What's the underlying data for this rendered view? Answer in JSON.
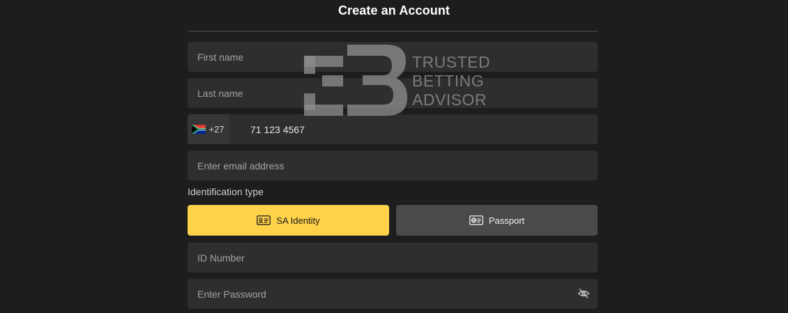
{
  "header": {
    "title": "Create an Account"
  },
  "form": {
    "first_name_placeholder": "First name",
    "last_name_placeholder": "Last name",
    "phone": {
      "country_code": "+27",
      "flag_icon": "south-africa-flag-icon",
      "value": "71 123 4567"
    },
    "email_placeholder": "Enter email address",
    "identification_label": "Identification type",
    "id_options": [
      {
        "label": "SA Identity",
        "icon": "id-card-icon",
        "selected": true
      },
      {
        "label": "Passport",
        "icon": "passport-icon",
        "selected": false
      }
    ],
    "id_number_placeholder": "ID Number",
    "password_placeholder": "Enter Password",
    "password_toggle_icon": "eye-slash-icon"
  },
  "watermark": {
    "line1": "TRUSTED",
    "line2": "BETTING",
    "line3": "ADVISOR"
  },
  "colors": {
    "background": "#1d1d1d",
    "field": "#2e2e2e",
    "accent": "#ffd24a",
    "secondary_button": "#4a4a4a"
  }
}
